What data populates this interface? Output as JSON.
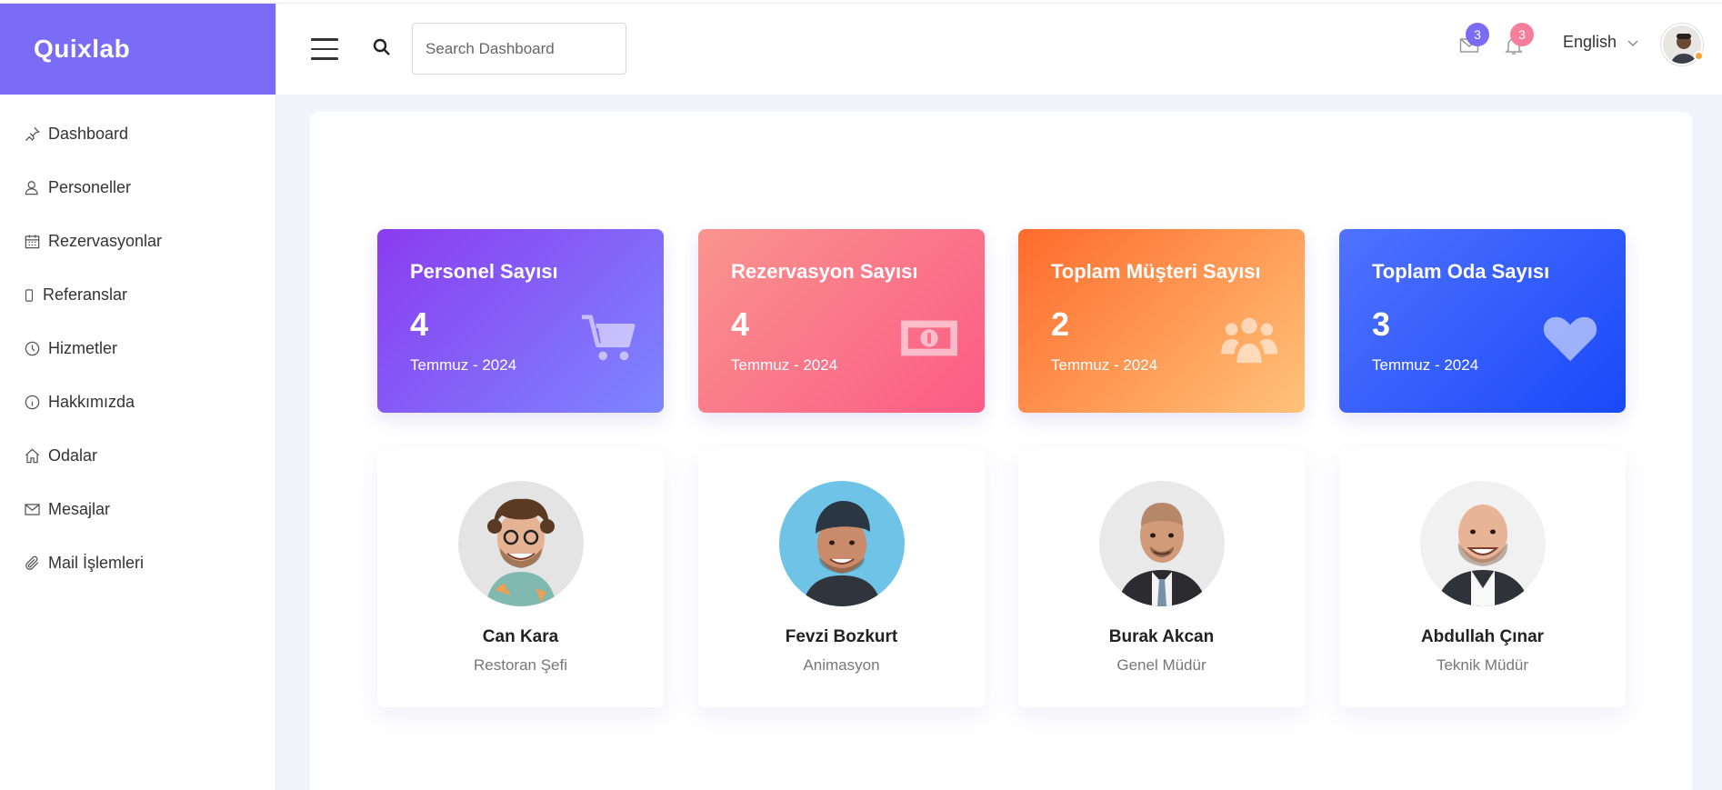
{
  "brand": {
    "name": "Quixlab"
  },
  "sidebar": {
    "items": [
      {
        "label": "Dashboard",
        "icon": "pin-icon"
      },
      {
        "label": "Personeller",
        "icon": "user-icon"
      },
      {
        "label": "Rezervasyonlar",
        "icon": "calendar-icon"
      },
      {
        "label": "Referanslar",
        "icon": "phone-icon"
      },
      {
        "label": "Hizmetler",
        "icon": "clock-icon"
      },
      {
        "label": "Hakkımızda",
        "icon": "info-icon"
      },
      {
        "label": "Odalar",
        "icon": "home-icon"
      },
      {
        "label": "Mesajlar",
        "icon": "envelope-icon"
      },
      {
        "label": "Mail İşlemleri",
        "icon": "paperclip-icon"
      }
    ]
  },
  "header": {
    "search_placeholder": "Search Dashboard",
    "mail_badge": "3",
    "notification_badge": "3",
    "language": "English"
  },
  "stats": [
    {
      "title": "Personel Sayısı",
      "value": "4",
      "date": "Temmuz - 2024",
      "icon": "cart-icon"
    },
    {
      "title": "Rezervasyon Sayısı",
      "value": "4",
      "date": "Temmuz - 2024",
      "icon": "money-icon"
    },
    {
      "title": "Toplam Müşteri Sayısı",
      "value": "2",
      "date": "Temmuz - 2024",
      "icon": "users-icon"
    },
    {
      "title": "Toplam Oda Sayısı",
      "value": "3",
      "date": "Temmuz - 2024",
      "icon": "heart-icon"
    }
  ],
  "staff": [
    {
      "name": "Can Kara",
      "role": "Restoran Şefi"
    },
    {
      "name": "Fevzi Bozkurt",
      "role": "Animasyon"
    },
    {
      "name": "Burak Akcan",
      "role": "Genel Müdür"
    },
    {
      "name": "Abdullah Çınar",
      "role": "Teknik Müdür"
    }
  ],
  "colors": {
    "brand": "#7b6cf6",
    "badge_purple": "#7b6cf6",
    "badge_pink": "#f77e9a",
    "online": "#f7a33b"
  }
}
